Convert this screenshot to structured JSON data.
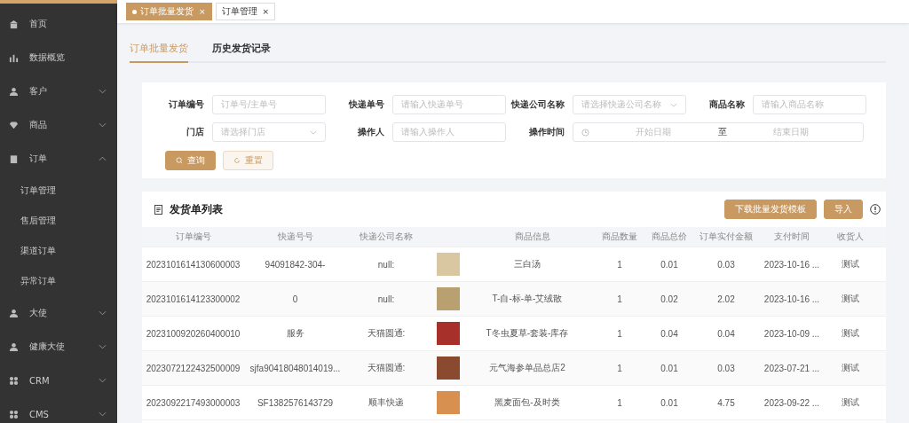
{
  "sidebar": {
    "items": [
      {
        "label": "首页"
      },
      {
        "label": "数据概览"
      },
      {
        "label": "客户",
        "expanded": false
      },
      {
        "label": "商品",
        "expanded": false
      },
      {
        "label": "订单",
        "expanded": true,
        "children": [
          {
            "label": "订单管理"
          },
          {
            "label": "售后管理"
          },
          {
            "label": "渠道订单"
          },
          {
            "label": "异常订单"
          }
        ]
      },
      {
        "label": "大使",
        "expanded": false
      },
      {
        "label": "健康大使",
        "expanded": false
      },
      {
        "label": "CRM",
        "expanded": false
      },
      {
        "label": "CMS",
        "expanded": false
      }
    ]
  },
  "page_tabs": [
    {
      "label": "订单批量发货",
      "selected": true,
      "close": "×"
    },
    {
      "label": "订单管理",
      "selected": false,
      "close": "×"
    }
  ],
  "sub_tabs": [
    {
      "label": "订单批量发货",
      "selected": true
    },
    {
      "label": "历史发货记录",
      "selected": false
    }
  ],
  "filters": [
    {
      "kind": "text",
      "label": "订单编号",
      "placeholder": "订单号/主单号"
    },
    {
      "kind": "text",
      "label": "快递单号",
      "placeholder": "请输入快递单号"
    },
    {
      "kind": "select",
      "label": "快递公司名称",
      "placeholder": "请选择快递公司名称"
    },
    {
      "kind": "text",
      "label": "商品名称",
      "placeholder": "请输入商品名称"
    },
    {
      "kind": "select",
      "label": "门店",
      "placeholder": "请选择门店"
    },
    {
      "kind": "text",
      "label": "操作人",
      "placeholder": "请输入操作人"
    },
    {
      "kind": "daterange",
      "label": "操作时间",
      "start_placeholder": "开始日期",
      "separator": "至",
      "end_placeholder": "结束日期"
    }
  ],
  "filter_buttons": [
    {
      "kind": "primary",
      "label": "查询"
    },
    {
      "kind": "plain",
      "label": "重置"
    }
  ],
  "list": {
    "title": "发货单列表",
    "buttons": [
      "下载批量发货模板",
      "导入"
    ],
    "columns": [
      "订单编号",
      "快递号号",
      "快递公司名称",
      "商品信息",
      "商品数量",
      "商品总价",
      "订单实付金额",
      "支付时间",
      "收货人"
    ],
    "rows": [
      {
        "order_no": "2023101614130600003",
        "tracking_no": "94091842-304-",
        "courier": "null:",
        "product": "三白汤",
        "quantity": "1",
        "total": "0.01",
        "paid": "0.03",
        "pay_time": "2023-10-16 ...",
        "receiver": "测试"
      },
      {
        "order_no": "2023101614123300002",
        "tracking_no": "0",
        "courier": "null:",
        "product": "T-自-标-单-艾绒散",
        "quantity": "1",
        "total": "0.02",
        "paid": "2.02",
        "pay_time": "2023-10-16 ...",
        "receiver": "测试"
      },
      {
        "order_no": "2023100920260400010",
        "tracking_no": "服务",
        "courier": "天猫圆通:",
        "product": "T冬虫夏草-套装-库存",
        "quantity": "1",
        "total": "0.04",
        "paid": "0.04",
        "pay_time": "2023-10-09 ...",
        "receiver": "测试"
      },
      {
        "order_no": "2023072122432500009",
        "tracking_no": "sjfa90418048014019...",
        "courier": "天猫圆通:",
        "product": "元气海参单品总店2",
        "quantity": "1",
        "total": "0.01",
        "paid": "0.03",
        "pay_time": "2023-07-21 ...",
        "receiver": "测试"
      },
      {
        "order_no": "2023092217493000003",
        "tracking_no": "SF1382576143729",
        "courier": "顺丰快递",
        "product": "黑麦面包-及时类",
        "quantity": "1",
        "total": "0.01",
        "paid": "4.75",
        "pay_time": "2023-09-22 ...",
        "receiver": "测试"
      }
    ]
  }
}
